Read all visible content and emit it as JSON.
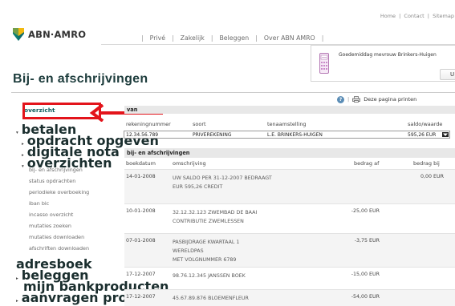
{
  "util_links": {
    "home": "Home",
    "sep1": "|",
    "contact": "Contact",
    "sep2": "|",
    "sitemap": "Sitemap"
  },
  "logo": {
    "text": "ABN·AMRO"
  },
  "main_nav": [
    {
      "label": "Privé"
    },
    {
      "label": "Zakelijk"
    },
    {
      "label": "Beleggen"
    },
    {
      "label": "Over ABN AMRO"
    }
  ],
  "greeting": "Goedemiddag mevrouw Brinkers-Huigen",
  "logout_label": "U",
  "page_title": "Bij- en afschrijvingen",
  "print_label": "Deze pagina printen",
  "print_sep": "|",
  "help_glyph": "?",
  "sidebar": {
    "overzicht": "overzicht",
    "betalen": "betalen",
    "opdracht_opgeven": "opdracht opgeven",
    "digitale_nota": "digitale nota",
    "overzichten": "overzichten",
    "sub_items": [
      "bij- en afschrijvingen",
      "status opdrachten",
      "periodieke overboeking",
      "iban bic",
      "incasso overzicht",
      "mutaties zoeken",
      "mutaties downloaden",
      "afschriften downloaden"
    ],
    "adresboek": "adresboek",
    "beleggen": "beleggen",
    "mijn_bankproducten": "mijn bankproducten",
    "aanvragen_product": "aanvragen product"
  },
  "accounts": {
    "heading": "van",
    "col_rekeningnummer": "rekeningnummer",
    "col_soort": "soort",
    "col_tenaamstelling": "tenaamstelling",
    "col_saldo": "saldo/waarde",
    "selected": {
      "rekeningnummer": "12.34.56.789",
      "soort": "PRIVEREKENING",
      "tenaamstelling": "L.E. BRINKERS-HUIGEN",
      "saldo": "595,26 EUR"
    }
  },
  "transactions": {
    "heading": "bij- en afschrijvingen",
    "col_boekdatum": "boekdatum",
    "col_omschrijving": "omschrijving",
    "col_bedrag_af": "bedrag af",
    "col_bedrag_bij": "bedrag bij",
    "rows": [
      {
        "date": "14-01-2008",
        "lines": [
          "UW SALDO PER 31-12-2007 BEDRAAGT",
          "EUR 595,26 CREDIT"
        ],
        "af": "",
        "bij": "0,00 EUR"
      },
      {
        "date": "10-01-2008",
        "lines": [
          "32.12.32.123 ZWEMBAD DE BAAI",
          "CONTRIBUTIE ZWEMLESSEN"
        ],
        "af": "-25,00 EUR",
        "bij": ""
      },
      {
        "date": "07-01-2008",
        "lines": [
          "PASBIJDRAGE KWARTAAL 1",
          "WERELDPAS",
          "MET VOLGNUMMER 6789"
        ],
        "af": "-3,75 EUR",
        "bij": ""
      },
      {
        "date": "17-12-2007",
        "lines": [
          "98.76.12.345 JANSSEN BOEK"
        ],
        "af": "-15,00 EUR",
        "bij": ""
      },
      {
        "date": "17-12-2007",
        "lines": [
          "45.67.89.876 BLOEMENFLEUR"
        ],
        "af": "-54,00 EUR",
        "bij": ""
      }
    ]
  },
  "colors": {
    "highlight_red": "#e3141b",
    "logo_teal": "#0d6b6b",
    "logo_yellow": "#f2b90f",
    "title_color": "#1d3c3c"
  }
}
